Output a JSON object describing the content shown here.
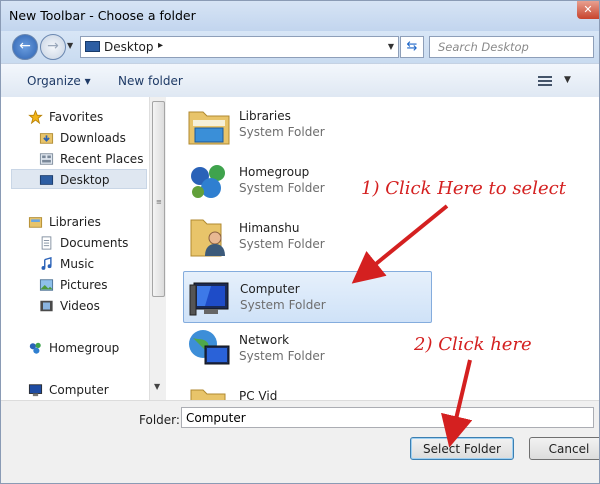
{
  "window": {
    "title": "New Toolbar - Choose a folder",
    "close_glyph": "✕"
  },
  "address": {
    "location": "Desktop",
    "separator": "▸",
    "dropdown_glyph": "▼"
  },
  "search": {
    "placeholder": "Search Desktop"
  },
  "toolbar": {
    "organize_label": "Organize ▾",
    "new_folder_label": "New folder"
  },
  "nav": {
    "favorites": [
      {
        "label": "Favorites",
        "icon": "star-icon"
      },
      {
        "label": "Downloads",
        "icon": "downloads-folder-icon"
      },
      {
        "label": "Recent Places",
        "icon": "recent-places-icon"
      },
      {
        "label": "Desktop",
        "icon": "desktop-icon",
        "selected": true
      }
    ],
    "libraries": [
      {
        "label": "Libraries",
        "icon": "libraries-icon"
      },
      {
        "label": "Documents",
        "icon": "documents-icon"
      },
      {
        "label": "Music",
        "icon": "music-icon"
      },
      {
        "label": "Pictures",
        "icon": "pictures-icon"
      },
      {
        "label": "Videos",
        "icon": "videos-icon"
      }
    ],
    "homegroup": {
      "label": "Homegroup",
      "icon": "homegroup-icon"
    },
    "computer": {
      "label": "Computer",
      "icon": "computer-icon"
    }
  },
  "files": [
    {
      "name": "Libraries",
      "type": "System Folder",
      "icon": "libraries-folder-icon"
    },
    {
      "name": "Homegroup",
      "type": "System Folder",
      "icon": "homegroup-icon"
    },
    {
      "name": "Himanshu",
      "type": "System Folder",
      "icon": "user-folder-icon"
    },
    {
      "name": "Computer",
      "type": "System Folder",
      "icon": "computer-icon",
      "selected": true
    },
    {
      "name": "Network",
      "type": "System Folder",
      "icon": "network-icon"
    },
    {
      "name": "PC Vid",
      "type": "",
      "icon": "folder-icon"
    }
  ],
  "annotations": {
    "step1": "1) Click Here to select",
    "step2": "2) Click here",
    "color": "#d42020"
  },
  "bottom": {
    "folder_label": "Folder:",
    "folder_value": "Computer",
    "select_button": "Select Folder",
    "cancel_button": "Cancel"
  },
  "colors": {
    "selection": "#cfe2f8",
    "accent": "#2e62b0"
  }
}
